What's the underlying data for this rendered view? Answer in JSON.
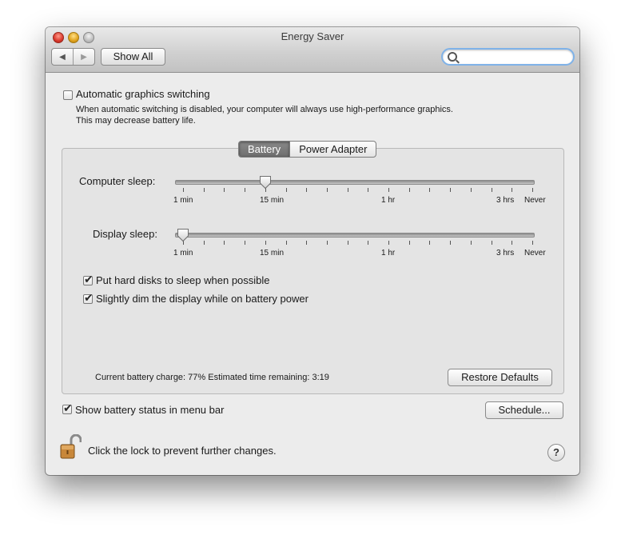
{
  "window": {
    "title": "Energy Saver"
  },
  "toolbar": {
    "back_glyph": "◀",
    "forward_glyph": "▶",
    "show_all_label": "Show All",
    "search_placeholder": "",
    "search_value": ""
  },
  "graphics": {
    "checkbox_checked": false,
    "label": "Automatic graphics switching",
    "description_line1": "When automatic switching is disabled, your computer will always use high-performance graphics.",
    "description_line2": "This may decrease battery life."
  },
  "tabs": [
    {
      "label": "Battery",
      "selected": true
    },
    {
      "label": "Power Adapter",
      "selected": false
    }
  ],
  "computer_sleep": {
    "label": "Computer sleep:",
    "selected_tick": 4,
    "tick_labels": [
      "1 min",
      "15 min",
      "1 hr",
      "3 hrs",
      "Never"
    ]
  },
  "display_sleep": {
    "label": "Display sleep:",
    "selected_tick": 0,
    "tick_labels": [
      "1 min",
      "15 min",
      "1 hr",
      "3 hrs",
      "Never"
    ]
  },
  "options": [
    {
      "label": "Put hard disks to sleep when possible",
      "checked": true
    },
    {
      "label": "Slightly dim the display while on battery power",
      "checked": true
    }
  ],
  "status": {
    "text": "Current battery charge: 77%  Estimated time remaining: 3:19",
    "restore_label": "Restore Defaults"
  },
  "menubar": {
    "label": "Show battery status in menu bar",
    "checked": true
  },
  "schedule_label": "Schedule...",
  "lock": {
    "text": "Click the lock to prevent further changes.",
    "icon": "unlocked-padlock-icon"
  },
  "help_glyph": "?",
  "colors": {
    "search_focus": "#7fb2e8",
    "window_bg": "#ececec",
    "panel_bg": "#e4e4e4",
    "lock_gold": "#c8873a"
  }
}
